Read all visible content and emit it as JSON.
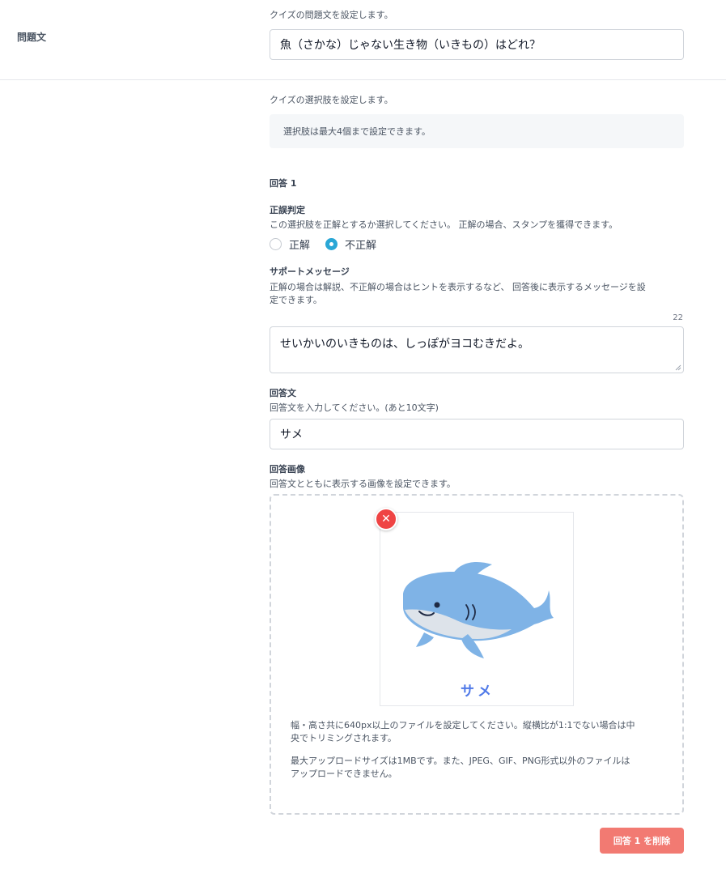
{
  "question": {
    "row_label": "問題文",
    "description": "クイズの問題文を設定します。",
    "value": "魚（さかな）じゃない生き物（いきもの）はどれ？"
  },
  "choices": {
    "description": "クイズの選択肢を設定します。",
    "note": "選択肢は最大4個まで設定できます。"
  },
  "answer1": {
    "heading": "回答 1",
    "correctness": {
      "label": "正誤判定",
      "description": "この選択肢を正解とするか選択してください。 正解の場合、スタンプを獲得できます。",
      "options": [
        {
          "label": "正解",
          "selected": false
        },
        {
          "label": "不正解",
          "selected": true
        }
      ]
    },
    "support_message": {
      "label": "サポートメッセージ",
      "description_line1": "正解の場合は解説、不正解の場合はヒントを表示するなど、 回答後に表示するメッセージを設",
      "description_line2": "定できます。",
      "counter": "22",
      "value": "せいかいのいきものは、しっぽがヨコむきだよ。"
    },
    "answer_text": {
      "label": "回答文",
      "description": "回答文を入力してください。(あと10文字)",
      "value": "サメ"
    },
    "answer_image": {
      "label": "回答画像",
      "description": "回答文とともに表示する画像を設定できます。",
      "caption": "サメ",
      "remove_icon": "close-icon",
      "note1_line1": "幅・高さ共に640px以上のファイルを設定してください。縦横比が1:1でない場合は中",
      "note1_line2": "央でトリミングされます。",
      "note2_line1": "最大アップロードサイズは1MBです。また、JPEG、GIF、PNG形式以外のファイルは",
      "note2_line2": "アップロードできません。"
    },
    "delete_label": "回答 1 を削除"
  },
  "colors": {
    "accent": "#2aa7d6",
    "danger": "#ef4444",
    "delete_button": "#f27a72",
    "shark_body": "#7fb3e6",
    "caption": "#4f79e8"
  }
}
